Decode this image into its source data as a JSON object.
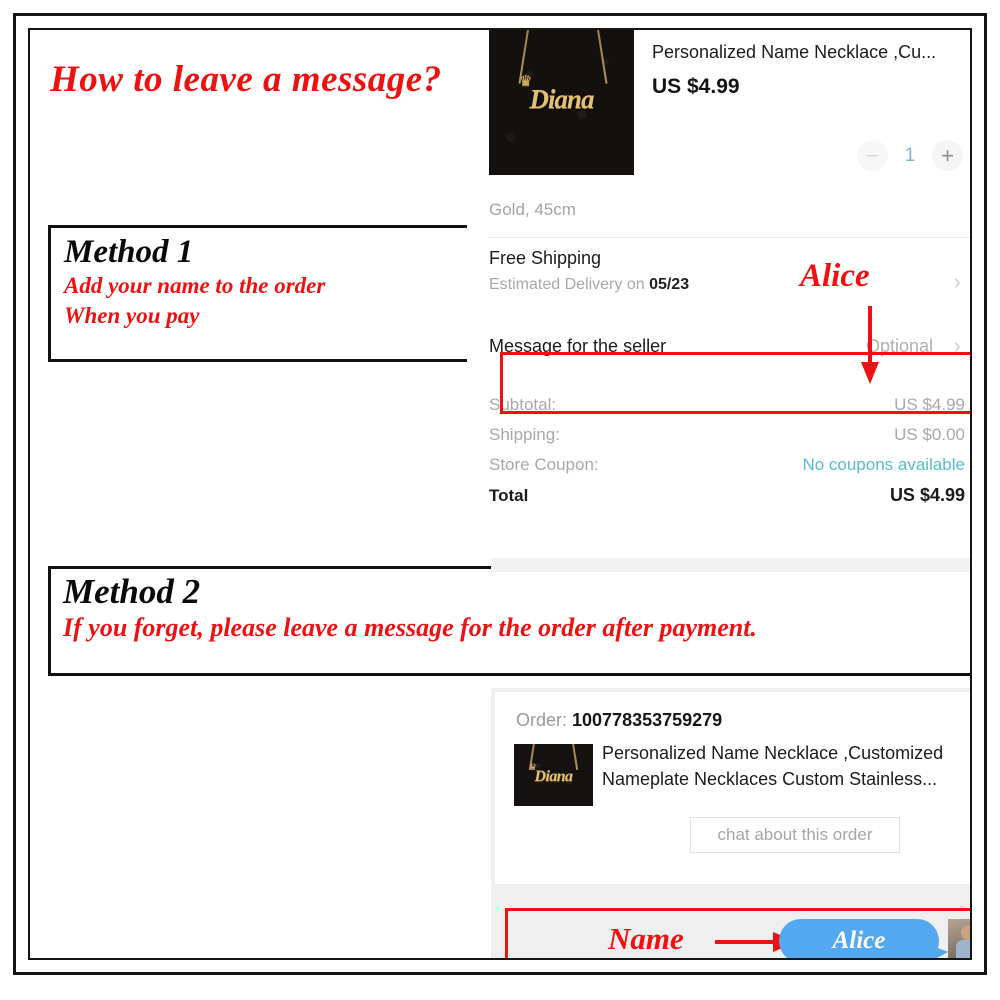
{
  "headline": "How to leave a message?",
  "method1": {
    "title": "Method 1",
    "line1": "Add your name to the order",
    "line2": "When you pay"
  },
  "method2": {
    "title": "Method 2",
    "line1": "If you forget, please leave a message for the order after payment."
  },
  "checkout": {
    "product": {
      "title": "Personalized Name Necklace ,Cu...",
      "price": "US $4.99",
      "variant": "Gold, 45cm",
      "thumb_name": "Diana",
      "crown": "♛"
    },
    "quantity": {
      "minus": "−",
      "value": "1",
      "plus": "+"
    },
    "shipping": {
      "title": "Free Shipping",
      "estimate_prefix": "Estimated Delivery on ",
      "estimate_date": "05/23",
      "chevron": "›"
    },
    "message_row": {
      "label": "Message for the seller",
      "value": "Optional",
      "chevron": "›"
    },
    "annotation": "Alice",
    "summary": [
      {
        "label": "Subtotal:",
        "value": "US $4.99",
        "kind": "normal"
      },
      {
        "label": "Shipping:",
        "value": "US $0.00",
        "kind": "normal"
      },
      {
        "label": "Store Coupon:",
        "value": "No coupons available",
        "kind": "coupon"
      },
      {
        "label": "Total",
        "value": "US $4.99",
        "kind": "total"
      }
    ]
  },
  "order": {
    "number_label": "Order: ",
    "number_value": "100778353759279",
    "product_title": "Personalized Name Necklace ,Customized Nameplate Necklaces Custom Stainless...",
    "thumb_name": "Diana",
    "crown": "♛",
    "chat_button": "chat about this order"
  },
  "chat": {
    "annotation": "Name",
    "bubble_text": "Alice"
  },
  "colors": {
    "annotation_red": "#ee1111",
    "bubble_blue": "#54a8f0",
    "coupon_teal": "#5bb8d4",
    "qty_blue": "#7fb4d6",
    "frame_black": "#151515"
  }
}
